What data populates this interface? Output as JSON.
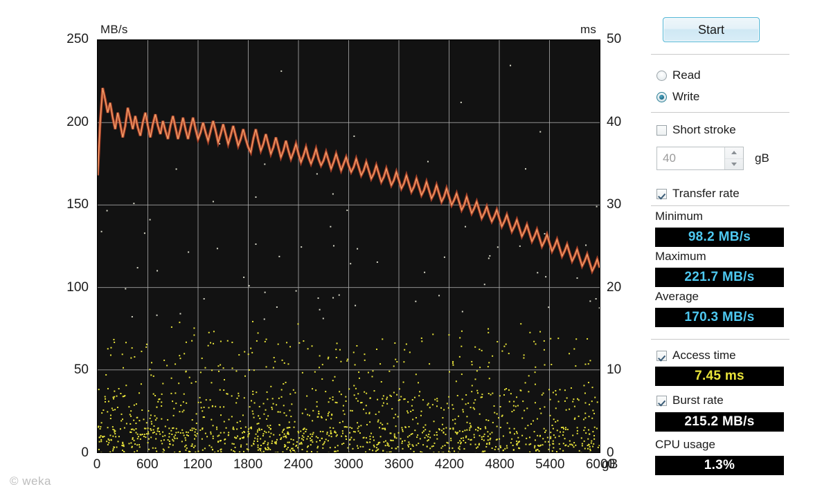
{
  "watermark": "© weka",
  "chart": {
    "unit_left": "MB/s",
    "unit_right": "ms",
    "x_unit": "gB",
    "y_left_ticks": [
      "250",
      "200",
      "150",
      "100",
      "50",
      "0"
    ],
    "y_right_ticks": [
      "50",
      "40",
      "30",
      "20",
      "10",
      "0"
    ],
    "x_ticks": [
      "0",
      "600",
      "1200",
      "1800",
      "2400",
      "3000",
      "3600",
      "4200",
      "4800",
      "5400",
      "6000"
    ],
    "colors": {
      "background": "#121212",
      "grid": "#b9b9b9",
      "transfer_line": "#f4a06a",
      "transfer_line_dark": "#c2482a",
      "access_dot": "#e9e43a",
      "page_background": "#ffffff"
    }
  },
  "chart_data": {
    "type": "line",
    "title": "",
    "xlabel": "gB",
    "ylabel": "MB/s",
    "y2label": "ms",
    "xlim": [
      0,
      6000
    ],
    "ylim": [
      0,
      250
    ],
    "y2lim": [
      0,
      50
    ],
    "grid": true,
    "legend": "none",
    "series": [
      {
        "name": "Transfer rate",
        "type": "line",
        "axis": "left",
        "unit": "MB/s",
        "color": "#f4a06a",
        "x": [
          0,
          30,
          60,
          90,
          120,
          150,
          180,
          210,
          240,
          270,
          300,
          330,
          360,
          390,
          420,
          450,
          480,
          510,
          540,
          570,
          600,
          630,
          660,
          690,
          720,
          750,
          780,
          810,
          840,
          870,
          900,
          930,
          960,
          990,
          1020,
          1050,
          1080,
          1110,
          1140,
          1170,
          1200,
          1230,
          1260,
          1290,
          1320,
          1350,
          1380,
          1410,
          1440,
          1470,
          1500,
          1530,
          1560,
          1590,
          1620,
          1650,
          1680,
          1710,
          1740,
          1770,
          1800,
          1830,
          1860,
          1890,
          1920,
          1950,
          1980,
          2010,
          2040,
          2070,
          2100,
          2130,
          2160,
          2190,
          2220,
          2250,
          2280,
          2310,
          2340,
          2370,
          2400,
          2430,
          2460,
          2490,
          2520,
          2550,
          2580,
          2610,
          2640,
          2670,
          2700,
          2730,
          2760,
          2790,
          2820,
          2850,
          2880,
          2910,
          2940,
          2970,
          3000,
          3030,
          3060,
          3090,
          3120,
          3150,
          3180,
          3210,
          3240,
          3270,
          3300,
          3330,
          3360,
          3390,
          3420,
          3450,
          3480,
          3510,
          3540,
          3570,
          3600,
          3630,
          3660,
          3690,
          3720,
          3750,
          3780,
          3810,
          3840,
          3870,
          3900,
          3930,
          3960,
          3990,
          4020,
          4050,
          4080,
          4110,
          4140,
          4170,
          4200,
          4230,
          4260,
          4290,
          4320,
          4350,
          4380,
          4410,
          4440,
          4470,
          4500,
          4530,
          4560,
          4590,
          4620,
          4650,
          4680,
          4710,
          4740,
          4770,
          4800,
          4830,
          4860,
          4890,
          4920,
          4950,
          4980,
          5010,
          5040,
          5070,
          5100,
          5130,
          5160,
          5190,
          5220,
          5250,
          5280,
          5310,
          5340,
          5370,
          5400,
          5430,
          5460,
          5490,
          5520,
          5550,
          5580,
          5610,
          5640,
          5670,
          5700,
          5730,
          5760,
          5790,
          5820,
          5850,
          5880,
          5910,
          5940,
          5970,
          6000
        ],
        "y": [
          168,
          200,
          221,
          214,
          206,
          212,
          203,
          196,
          206,
          199,
          191,
          198,
          209,
          203,
          196,
          204,
          197,
          192,
          200,
          206,
          198,
          191,
          199,
          205,
          198,
          193,
          201,
          195,
          190,
          198,
          204,
          197,
          190,
          196,
          203,
          196,
          190,
          197,
          203,
          196,
          190,
          194,
          200,
          194,
          189,
          195,
          201,
          195,
          188,
          193,
          199,
          193,
          187,
          192,
          198,
          192,
          186,
          190,
          196,
          190,
          185,
          182,
          190,
          196,
          189,
          183,
          187,
          193,
          187,
          181,
          185,
          191,
          185,
          179,
          183,
          189,
          183,
          178,
          182,
          187,
          181,
          176,
          180,
          185,
          179,
          175,
          179,
          184,
          178,
          174,
          177,
          182,
          177,
          172,
          176,
          181,
          176,
          171,
          175,
          179,
          174,
          170,
          173,
          178,
          173,
          168,
          171,
          176,
          171,
          166,
          169,
          174,
          169,
          164,
          167,
          172,
          167,
          162,
          165,
          170,
          165,
          160,
          163,
          168,
          163,
          158,
          161,
          166,
          161,
          156,
          159,
          164,
          159,
          154,
          157,
          162,
          157,
          152,
          155,
          160,
          155,
          150,
          153,
          157,
          152,
          147,
          150,
          155,
          150,
          145,
          148,
          152,
          147,
          142,
          145,
          149,
          144,
          140,
          143,
          147,
          142,
          137,
          140,
          144,
          139,
          134,
          137,
          141,
          136,
          131,
          134,
          138,
          133,
          128,
          131,
          135,
          130,
          125,
          128,
          132,
          127,
          122,
          125,
          129,
          124,
          119,
          122,
          126,
          121,
          116,
          119,
          123,
          118,
          113,
          116,
          120,
          115,
          110,
          113,
          117,
          112,
          107,
          105
        ]
      },
      {
        "name": "Access time",
        "type": "scatter",
        "axis": "right",
        "unit": "ms",
        "color": "#e9e43a",
        "description": "Yellow dots scattered mostly between 0 and 15 ms, densest below 6 ms, sparse outliers up to 45 ms"
      }
    ]
  },
  "sidebar": {
    "start_label": "Start",
    "mode": {
      "read_label": "Read",
      "write_label": "Write",
      "selected": "Write"
    },
    "short_stroke": {
      "label": "Short stroke",
      "checked": false,
      "value": "40",
      "unit": "gB"
    },
    "transfer_rate": {
      "label": "Transfer rate",
      "checked": true,
      "minimum_label": "Minimum",
      "minimum_value": "98.2 MB/s",
      "maximum_label": "Maximum",
      "maximum_value": "221.7 MB/s",
      "average_label": "Average",
      "average_value": "170.3 MB/s"
    },
    "access_time": {
      "label": "Access time",
      "checked": true,
      "value": "7.45 ms"
    },
    "burst_rate": {
      "label": "Burst rate",
      "checked": true,
      "value": "215.2 MB/s"
    },
    "cpu_usage": {
      "label": "CPU usage",
      "value": "1.3%"
    }
  }
}
